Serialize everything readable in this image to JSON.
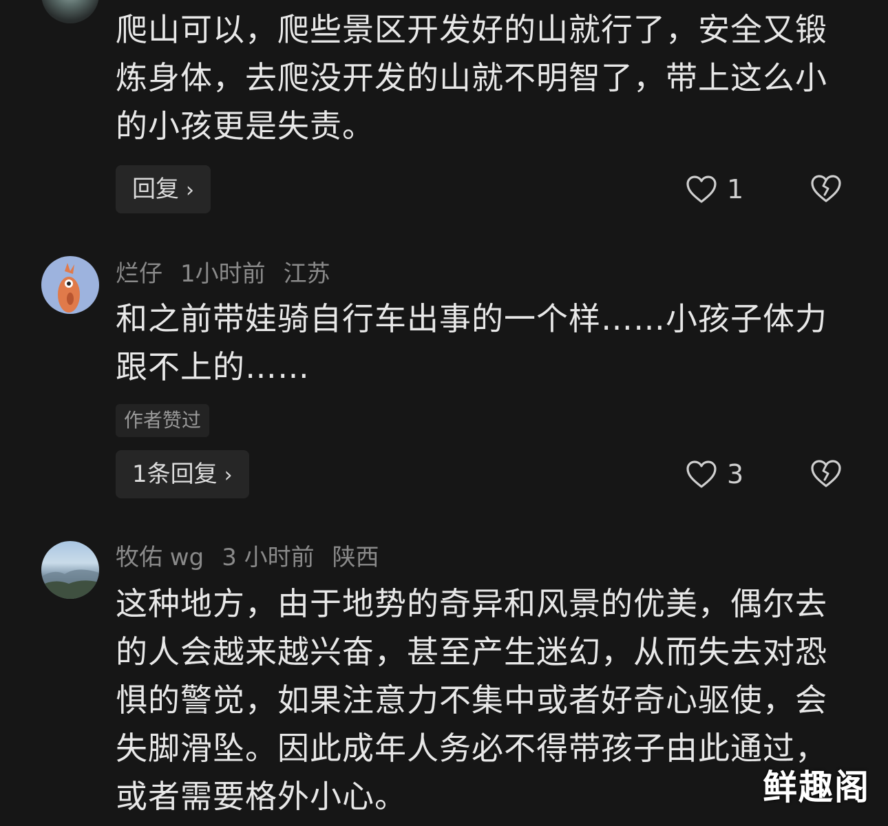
{
  "comments": [
    {
      "text_lines": [
        "爬山可以，爬些景区开发好的山就行了，安全又锻",
        "炼身体，去爬没开发的山就不明智了，带上这么小",
        "的小孩更是失责。"
      ],
      "reply_label": "回复",
      "likes": "1"
    },
    {
      "username": "烂仔",
      "time": "1小时前",
      "location": "江苏",
      "text_lines": [
        "和之前带娃骑自行车出事的一个样……小孩子体力",
        "跟不上的……"
      ],
      "author_badge": "作者赞过",
      "reply_label": "1条回复",
      "likes": "3"
    },
    {
      "username": "牧佑 wg",
      "time": "3 小时前",
      "location": "陕西",
      "text_lines": [
        "这种地方，由于地势的奇异和风景的优美，偶尔去",
        "的人会越来越兴奋，甚至产生迷幻，从而失去对恐",
        "惧的警觉，如果注意力不集中或者好奇心驱使，会",
        "失脚滑坠。因此成年人务必不得带孩子由此通过，",
        "或者需要格外小心。"
      ]
    }
  ],
  "icons": {
    "like": "heart-outline-icon",
    "dislike": "broken-heart-icon",
    "chevron": "chevron-right-icon"
  },
  "colors": {
    "background": "#161616",
    "text": "#e8e8e8",
    "meta": "#8a8a8a",
    "button_bg": "#262626"
  },
  "watermark": "鲜趣阁"
}
